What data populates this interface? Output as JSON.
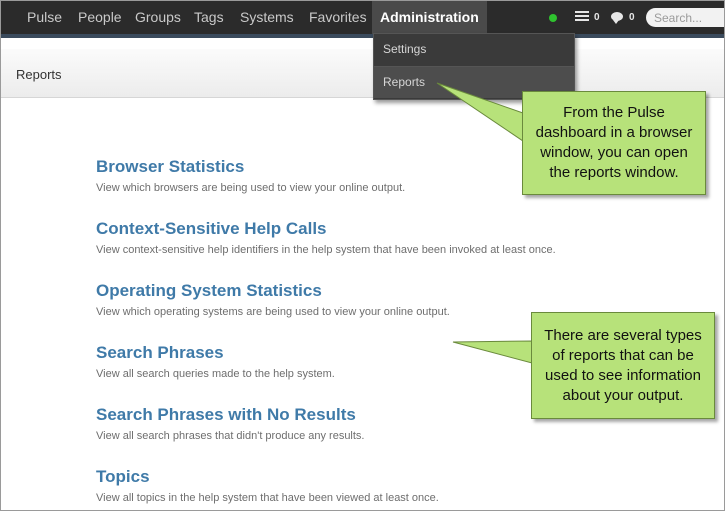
{
  "nav": {
    "items": [
      "Pulse",
      "People",
      "Groups",
      "Tags",
      "Systems",
      "Favorites"
    ],
    "active": "Administration",
    "status_color": "#2fc22f",
    "list_count": "0",
    "chat_count": "0",
    "search_placeholder": "Search..."
  },
  "dropdown": {
    "items": [
      "Settings",
      "Reports"
    ]
  },
  "header": {
    "title": "Reports"
  },
  "reports": [
    {
      "title": "Browser Statistics",
      "desc": "View which browsers are being used to view your online output."
    },
    {
      "title": "Context-Sensitive Help Calls",
      "desc": "View context-sensitive help identifiers in the help system that have been invoked at least once."
    },
    {
      "title": "Operating System Statistics",
      "desc": "View which operating systems are being used to view your online output."
    },
    {
      "title": "Search Phrases",
      "desc": "View all search queries made to the help system."
    },
    {
      "title": "Search Phrases with No Results",
      "desc": "View all search phrases that didn't produce any results."
    },
    {
      "title": "Topics",
      "desc": "View all topics in the help system that have been viewed at least once."
    }
  ],
  "callouts": [
    {
      "text": "From the Pulse dashboard in a browser window, you can open the reports window."
    },
    {
      "text": "There are several types of reports that can be used to see information about your output."
    }
  ],
  "colors": {
    "callout_fill": "#b7e27a",
    "link": "#3f7aa8",
    "topbar": "#2b2b2b"
  }
}
